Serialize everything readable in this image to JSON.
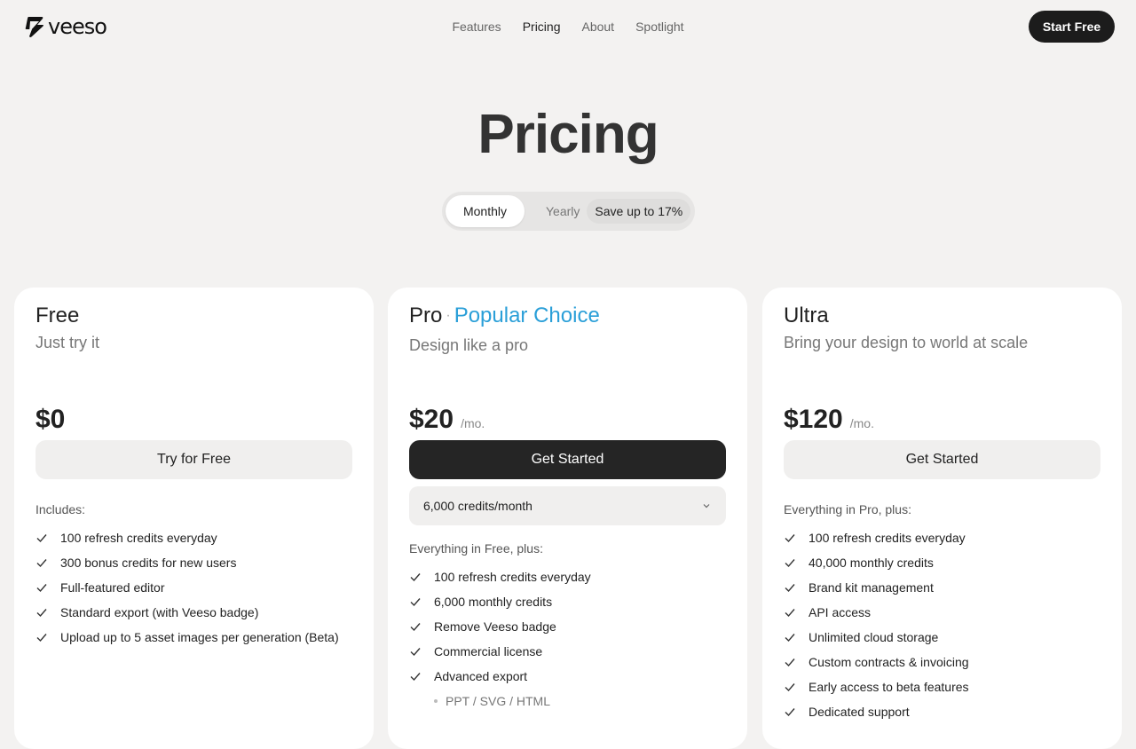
{
  "brand": {
    "name": "veeso"
  },
  "nav": {
    "items": [
      {
        "label": "Features"
      },
      {
        "label": "Pricing"
      },
      {
        "label": "About"
      },
      {
        "label": "Spotlight"
      }
    ],
    "active": "Pricing",
    "cta_label": "Start Free"
  },
  "page": {
    "title": "Pricing"
  },
  "billing_toggle": {
    "monthly_label": "Monthly",
    "yearly_label": "Yearly",
    "save_badge": "Save up to 17%",
    "selected": "Monthly"
  },
  "plans": [
    {
      "name": "Free",
      "tagline": "Just try it",
      "price": "$0",
      "per": "",
      "cta_label": "Try for Free",
      "includes_label": "Includes:",
      "features": [
        "100 refresh credits everyday",
        "300 bonus credits for new users",
        "Full-featured editor",
        "Standard export (with Veeso badge)",
        "Upload up to 5 asset images per generation (Beta)"
      ]
    },
    {
      "name": "Pro",
      "badge": "Popular Choice",
      "tagline": "Design like a pro",
      "price": "$20",
      "per": "/mo.",
      "cta_label": "Get Started",
      "credits_option": "6,000 credits/month",
      "includes_label": "Everything in Free, plus:",
      "features": [
        "100 refresh credits everyday",
        "6,000 monthly credits",
        "Remove Veeso badge",
        "Commercial license",
        "Advanced export"
      ],
      "sub_features": [
        "PPT / SVG / HTML"
      ]
    },
    {
      "name": "Ultra",
      "tagline": "Bring your design to world at scale",
      "price": "$120",
      "per": "/mo.",
      "cta_label": "Get Started",
      "includes_label": "Everything in Pro, plus:",
      "features": [
        "100 refresh credits everyday",
        "40,000 monthly credits",
        "Brand kit management",
        "API access",
        "Unlimited cloud storage",
        "Custom contracts & invoicing",
        "Early access to beta features",
        "Dedicated support"
      ]
    }
  ],
  "colors": {
    "background": "#f3f2f1",
    "accent": "#2a9fd8",
    "primary_button": "#1c1c1c"
  }
}
